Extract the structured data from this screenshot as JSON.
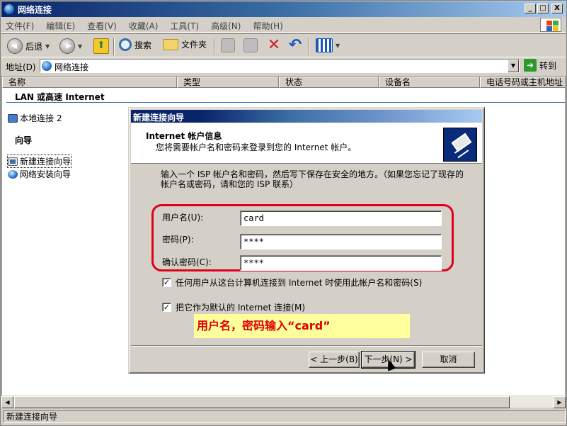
{
  "window": {
    "title": "网络连接",
    "buttons": [
      "_",
      "□",
      "X"
    ]
  },
  "menu": [
    "文件(F)",
    "编辑(E)",
    "查看(V)",
    "收藏(A)",
    "工具(T)",
    "高级(N)",
    "帮助(H)"
  ],
  "toolbar": {
    "back_label": "后退",
    "search_label": "搜索",
    "folders_label": "文件夹"
  },
  "address": {
    "label": "地址(D)",
    "value": "网络连接",
    "go_label": "转到"
  },
  "columns": [
    "名称",
    "类型",
    "状态",
    "设备名",
    "电话号码或主机地址"
  ],
  "groups": {
    "lan_title": "LAN 或高速 Internet",
    "wizard_title": "向导"
  },
  "items": {
    "lan_connection": "本地连接 2",
    "new_connection_wizard": "新建连接向导",
    "network_setup_wizard": "网络安装向导"
  },
  "status_bar": "新建连接向导",
  "dialog": {
    "title": "新建连接向导",
    "header_title": "Internet 帐户信息",
    "header_subtitle": "您将需要帐户名和密码来登录到您的 Internet 帐户。",
    "description": "输入一个 ISP 帐户名和密码，然后写下保存在安全的地方。（如果您忘记了现存的帐户名或密码，请和您的 ISP 联系）",
    "username_label": "用户名(U):",
    "username_value": "card",
    "password_label": "密码(P):",
    "password_value": "****",
    "confirm_label": "确认密码(C):",
    "confirm_value": "****",
    "check1_label": "任何用户从这台计算机连接到 Internet 时使用此帐户名和密码(S)",
    "check1_checked": "✓",
    "check2_label": "把它作为默认的 Internet 连接(M)",
    "check2_checked": "✓",
    "annotation": "用户名，密码输入“card”",
    "back_button": "< 上一步(B)",
    "next_button": "下一步(N) >",
    "cancel_button": "取消"
  },
  "colors": {
    "annotation_frame": "#e0001b",
    "annotation_bg": "#ffff9e",
    "annotation_text": "#e00000"
  }
}
